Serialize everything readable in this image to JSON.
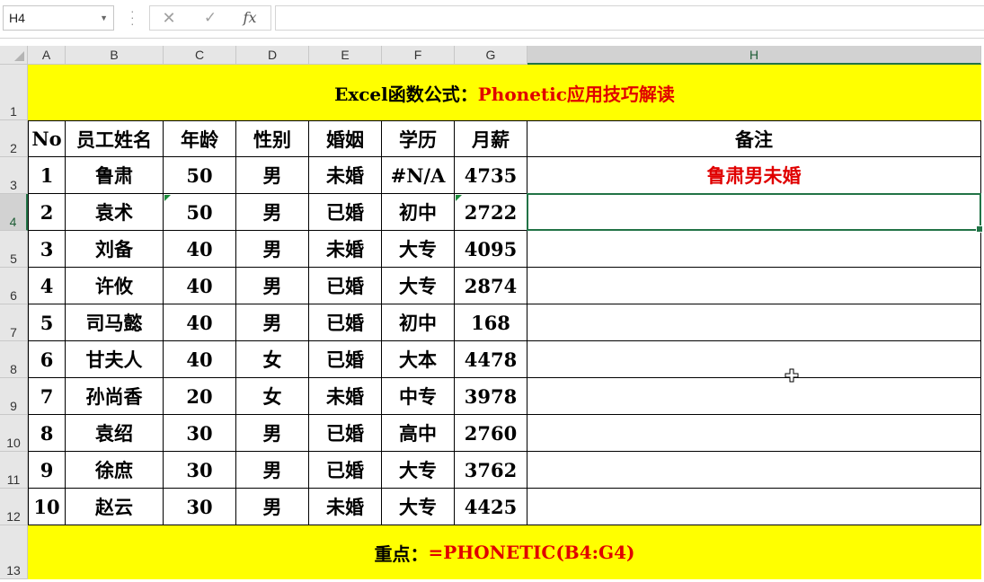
{
  "formula_bar": {
    "name_box": "H4",
    "cancel_icon": "close-icon",
    "enter_icon": "check-icon",
    "function_icon_label": "fx",
    "formula": ""
  },
  "columns": [
    "A",
    "B",
    "C",
    "D",
    "E",
    "F",
    "G",
    "H"
  ],
  "rows": [
    "1",
    "2",
    "3",
    "4",
    "5",
    "6",
    "7",
    "8",
    "9",
    "10",
    "11",
    "12",
    "13"
  ],
  "selected": {
    "column": "H",
    "row": "4"
  },
  "title_banner": {
    "black_part": "Excel函数公式：",
    "red_part": "Phonetic应用技巧解读"
  },
  "table": {
    "headers": [
      "No",
      "员工姓名",
      "年龄",
      "性别",
      "婚姻",
      "学历",
      "月薪",
      "备注"
    ],
    "rows": [
      [
        "1",
        "鲁肃",
        "50",
        "男",
        "未婚",
        "#N/A",
        "4735",
        "鲁肃男未婚"
      ],
      [
        "2",
        "袁术",
        "50",
        "男",
        "已婚",
        "初中",
        "2722",
        ""
      ],
      [
        "3",
        "刘备",
        "40",
        "男",
        "未婚",
        "大专",
        "4095",
        ""
      ],
      [
        "4",
        "许攸",
        "40",
        "男",
        "已婚",
        "大专",
        "2874",
        ""
      ],
      [
        "5",
        "司马懿",
        "40",
        "男",
        "已婚",
        "初中",
        "168",
        ""
      ],
      [
        "6",
        "甘夫人",
        "40",
        "女",
        "已婚",
        "大本",
        "4478",
        ""
      ],
      [
        "7",
        "孙尚香",
        "20",
        "女",
        "未婚",
        "中专",
        "3978",
        ""
      ],
      [
        "8",
        "袁绍",
        "30",
        "男",
        "已婚",
        "高中",
        "2760",
        ""
      ],
      [
        "9",
        "徐庶",
        "30",
        "男",
        "已婚",
        "大专",
        "3762",
        ""
      ],
      [
        "10",
        "赵云",
        "30",
        "男",
        "未婚",
        "大专",
        "4425",
        ""
      ]
    ]
  },
  "footer_banner": {
    "black_part": "重点：",
    "red_part": "=PHONETIC(B4:G4)"
  },
  "colors": {
    "banner": "#ffff00",
    "accent_red": "#e00000",
    "selection_green": "#217346"
  }
}
